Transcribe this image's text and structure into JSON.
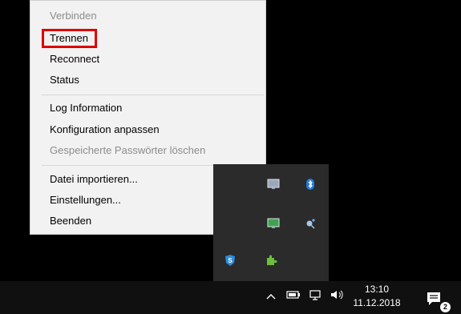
{
  "menu": {
    "items": [
      {
        "label": "Verbinden",
        "disabled": true
      },
      {
        "label": "Trennen",
        "disabled": false,
        "highlighted": true
      },
      {
        "label": "Reconnect",
        "disabled": false
      },
      {
        "label": "Status",
        "disabled": false
      },
      {
        "label": "Log Information",
        "disabled": false
      },
      {
        "label": "Konfiguration anpassen",
        "disabled": false
      },
      {
        "label": "Gespeicherte Passwörter löschen",
        "disabled": true
      },
      {
        "label": "Datei importieren...",
        "disabled": false
      },
      {
        "label": "Einstellungen...",
        "disabled": false
      },
      {
        "label": "Beenden",
        "disabled": false
      }
    ]
  },
  "tray_flyout": {
    "icons": [
      "monitor-icon",
      "bluetooth-icon",
      "network-monitor-icon",
      "search-plus-icon",
      "s-shield-icon",
      "puzzle-icon"
    ]
  },
  "taskbar": {
    "time": "13:10",
    "date": "11.12.2018",
    "notification_count": "2",
    "icons": [
      "chevron-up-icon",
      "battery-icon",
      "network-icon",
      "volume-icon",
      "notification-center-icon"
    ]
  },
  "colors": {
    "highlight_border": "#e00000",
    "menu_bg": "#f2f2f2",
    "taskbar_bg": "#101010",
    "flyout_bg": "#2b2b2b",
    "bluetooth": "#1f7bd8"
  }
}
